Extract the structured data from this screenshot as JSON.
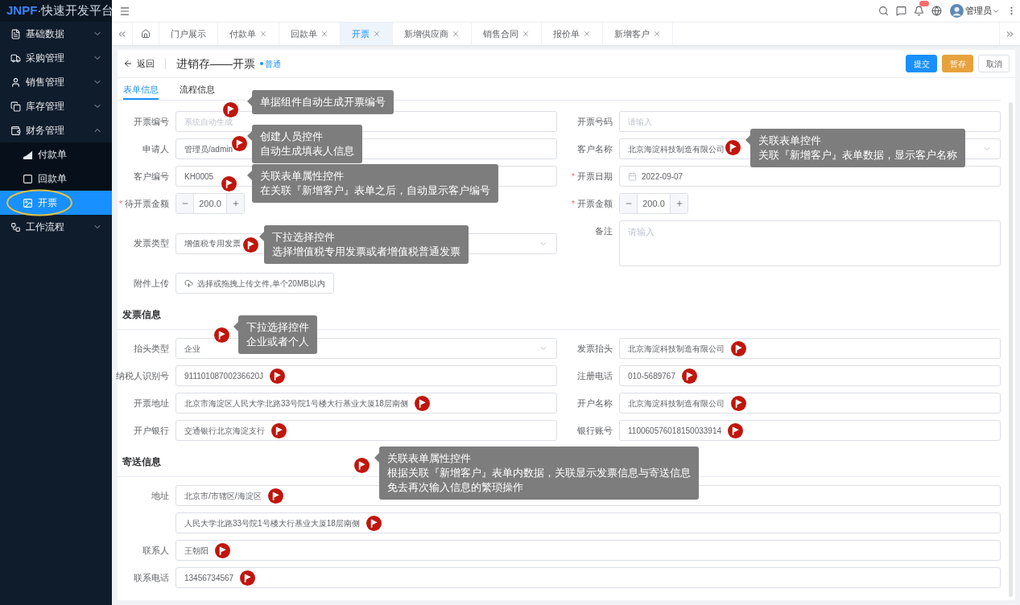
{
  "logo": {
    "brand": "JNPF",
    "product": "·快速开发平台"
  },
  "sidebar": {
    "items": [
      {
        "label": "基础数据",
        "expanded": false
      },
      {
        "label": "采购管理",
        "expanded": false
      },
      {
        "label": "销售管理",
        "expanded": false
      },
      {
        "label": "库存管理",
        "expanded": false
      },
      {
        "label": "财务管理",
        "expanded": true,
        "children": [
          {
            "label": "付款单",
            "selected": false,
            "circled": false
          },
          {
            "label": "回款单",
            "selected": false,
            "circled": false
          },
          {
            "label": "开票",
            "selected": true,
            "circled": true
          }
        ]
      },
      {
        "label": "工作流程",
        "expanded": false
      }
    ]
  },
  "header": {
    "user": "管理员"
  },
  "tabs": [
    {
      "kind": "home",
      "selected": false
    },
    {
      "kind": "tab",
      "label": "门户展示",
      "selected": false
    },
    {
      "kind": "tab",
      "label": "付款单",
      "closable": true,
      "selected": false
    },
    {
      "kind": "tab",
      "label": "回款单",
      "closable": true,
      "selected": false
    },
    {
      "kind": "tab",
      "label": "开票",
      "closable": true,
      "selected": true
    },
    {
      "kind": "tab",
      "label": "新增供应商",
      "closable": true,
      "selected": false
    },
    {
      "kind": "tab",
      "label": "销售合同",
      "closable": true,
      "selected": false
    },
    {
      "kind": "tab",
      "label": "报价单",
      "closable": true,
      "selected": false
    },
    {
      "kind": "tab",
      "label": "新增客户",
      "closable": true,
      "selected": false
    }
  ],
  "page": {
    "back": "返回",
    "title": "进销存——开票",
    "status": "普通",
    "buttons": [
      {
        "label": "提交",
        "kind": "primary"
      },
      {
        "label": "暂存",
        "kind": "warning"
      },
      {
        "label": "取消",
        "kind": "default"
      }
    ]
  },
  "form_tabs": [
    {
      "label": "表单信息",
      "selected": true
    },
    {
      "label": "流程信息",
      "selected": false
    }
  ],
  "sections": [
    {
      "fields": [
        {
          "label": "开票编号",
          "kind": "text",
          "placeholder": "系统自动生成"
        },
        {
          "label": "开票号码",
          "kind": "text",
          "placeholder": "请输入"
        },
        {
          "label": "申请人",
          "kind": "text",
          "value": "管理员/admin"
        },
        {
          "label": "客户名称",
          "kind": "select",
          "value": "北京海淀科技制造有限公司"
        },
        {
          "label": "客户编号",
          "kind": "text",
          "value": "KH0005"
        },
        {
          "label": "开票日期",
          "required_mark": "*",
          "kind": "date",
          "value": "2022-09-07"
        },
        {
          "label": "待开票金额",
          "required_mark": "*",
          "kind": "number",
          "value": "200.0"
        },
        {
          "label": "开票金额",
          "required_mark": "*",
          "kind": "number",
          "value": "200.0"
        },
        {
          "label": "发票类型",
          "kind": "select",
          "value": "增值税专用发票"
        },
        {
          "label": "备注",
          "kind": "textarea",
          "placeholder": "请输入"
        },
        {
          "label": "附件上传",
          "kind": "upload",
          "button": "选择或拖拽上传文件,单个20MB以内"
        }
      ]
    },
    {
      "title": "发票信息",
      "fields": [
        {
          "label": "抬头类型",
          "kind": "select",
          "value": "企业"
        },
        {
          "label": "发票抬头",
          "kind": "text",
          "value": "北京海淀科技制造有限公司",
          "marker": true
        },
        {
          "label": "纳税人识别号",
          "kind": "text",
          "value": "91110108700236620J",
          "marker": true
        },
        {
          "label": "注册电话",
          "kind": "text",
          "value": "010-5689767",
          "marker": true
        },
        {
          "label": "开票地址",
          "kind": "text",
          "value": "北京市海淀区人民大学北路33号院1号楼大行基业大厦18层南侧",
          "marker": true
        },
        {
          "label": "开户名称",
          "kind": "text",
          "value": "北京海淀科技制造有限公司",
          "marker": true
        },
        {
          "label": "开户银行",
          "kind": "text",
          "value": "交通银行北京海淀支行",
          "marker": true
        },
        {
          "label": "银行账号",
          "kind": "text",
          "value": "110060576018150033914",
          "marker": true
        }
      ]
    },
    {
      "title": "寄送信息",
      "fields": [
        {
          "label": "地址",
          "kind": "text",
          "value": "北京市/市辖区/海淀区",
          "marker": true
        },
        {
          "kind": "text",
          "value": "人民大学北路33号院1号楼大行基业大厦18层南侧",
          "marker": true
        },
        {
          "label": "联系人",
          "kind": "text",
          "value": "王朝阳",
          "marker": true
        },
        {
          "label": "联系电话",
          "kind": "text",
          "value": "13456734567",
          "marker": true
        }
      ]
    }
  ],
  "callouts": [
    {
      "lines": [
        "单据组件自动生成开票编号"
      ]
    },
    {
      "lines": [
        "创建人员控件",
        "自动生成填表人信息"
      ]
    },
    {
      "lines": [
        "关联表单属性控件",
        "在关联『新增客户』表单之后，自动显示客户编号"
      ]
    },
    {
      "lines": [
        "关联表单控件",
        "关联『新增客户』表单数据，显示客户名称"
      ]
    },
    {
      "lines": [
        "下拉选择控件",
        "选择增值税专用发票或者增值税普通发票"
      ]
    },
    {
      "lines": [
        "下拉选择控件",
        "企业或者个人"
      ]
    },
    {
      "lines": [
        "关联表单属性控件",
        "根据关联『新增客户』表单内数据，关联显示发票信息与寄送信息",
        "免去再次输入信息的繁琐操作"
      ]
    }
  ]
}
